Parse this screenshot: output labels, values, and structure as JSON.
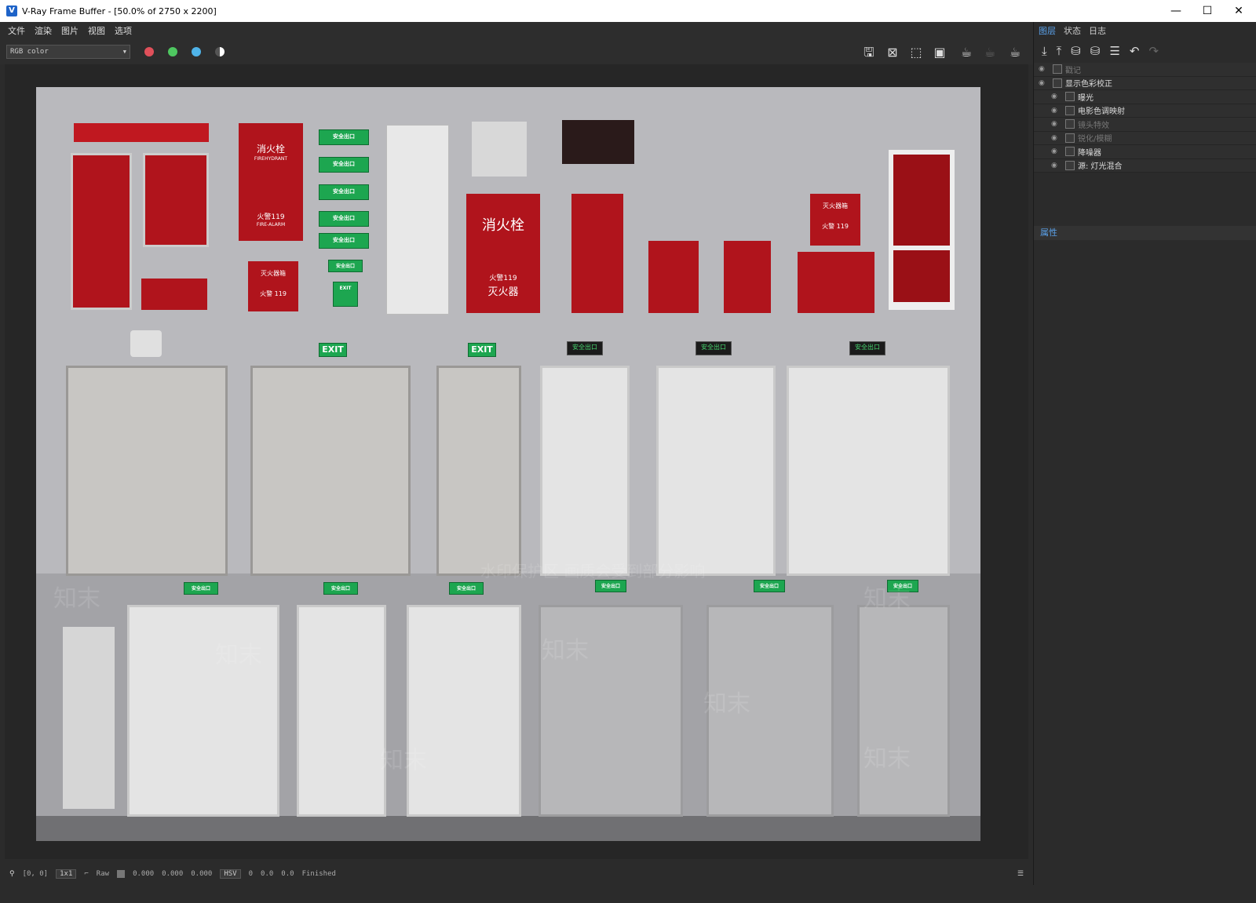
{
  "window": {
    "title": "V-Ray Frame Buffer - [50.0% of 2750 x 2200]",
    "app_icon": "vray-icon",
    "minimize": "—",
    "maximize": "☐",
    "close": "✕"
  },
  "menu": [
    "文件",
    "渲染",
    "图片",
    "视图",
    "选项"
  ],
  "toolbar": {
    "channel": "RGB color",
    "channel_dots": [
      "#e0505a",
      "#4ec760",
      "#4fb3e8"
    ]
  },
  "render": {
    "cabinet_labels": {
      "hydrant_big": "消火栓",
      "hydrant_sub": "火警119",
      "hydrant_sub2": "灭火器",
      "tall_cab_top": "消火栓",
      "tall_cab_sub": "FIREHYDRANT",
      "tall_cab_mid": "火警119",
      "tall_cab_mid2": "FIRE-ALARM",
      "small_box": "灭火器箱",
      "small_box_sub": "火警 119",
      "right_box": "灭火器箱",
      "right_box_sub": "火警 119"
    },
    "exit_text": "EXIT",
    "safe_exit": "安全出口",
    "safe_exit_en": "EXIT",
    "watermark_brand": "知末",
    "watermark_notice": "水印保护区  画质会受到部分影响"
  },
  "right_panel": {
    "tabs": [
      "图层",
      "状态",
      "日志"
    ],
    "layers": [
      {
        "label": "戳记",
        "dim": true,
        "indent": 0
      },
      {
        "label": "显示色彩校正",
        "dim": false,
        "indent": 0
      },
      {
        "label": "曝光",
        "dim": false,
        "indent": 1
      },
      {
        "label": "电影色调映射",
        "dim": false,
        "indent": 1
      },
      {
        "label": "镜头特效",
        "dim": true,
        "indent": 1
      },
      {
        "label": "锐化/模糊",
        "dim": true,
        "indent": 1
      },
      {
        "label": "降噪器",
        "dim": false,
        "indent": 1
      },
      {
        "label": "源: 灯光混合",
        "dim": false,
        "indent": 1
      }
    ],
    "properties_title": "属性"
  },
  "status": {
    "coords": "[0, 0]",
    "zoom": "1x1",
    "mode": "Raw",
    "r": "0.000",
    "g": "0.000",
    "b": "0.000",
    "colorspace": "HSV",
    "h": "0",
    "s": "0.0",
    "v": "0.0",
    "state": "Finished"
  }
}
